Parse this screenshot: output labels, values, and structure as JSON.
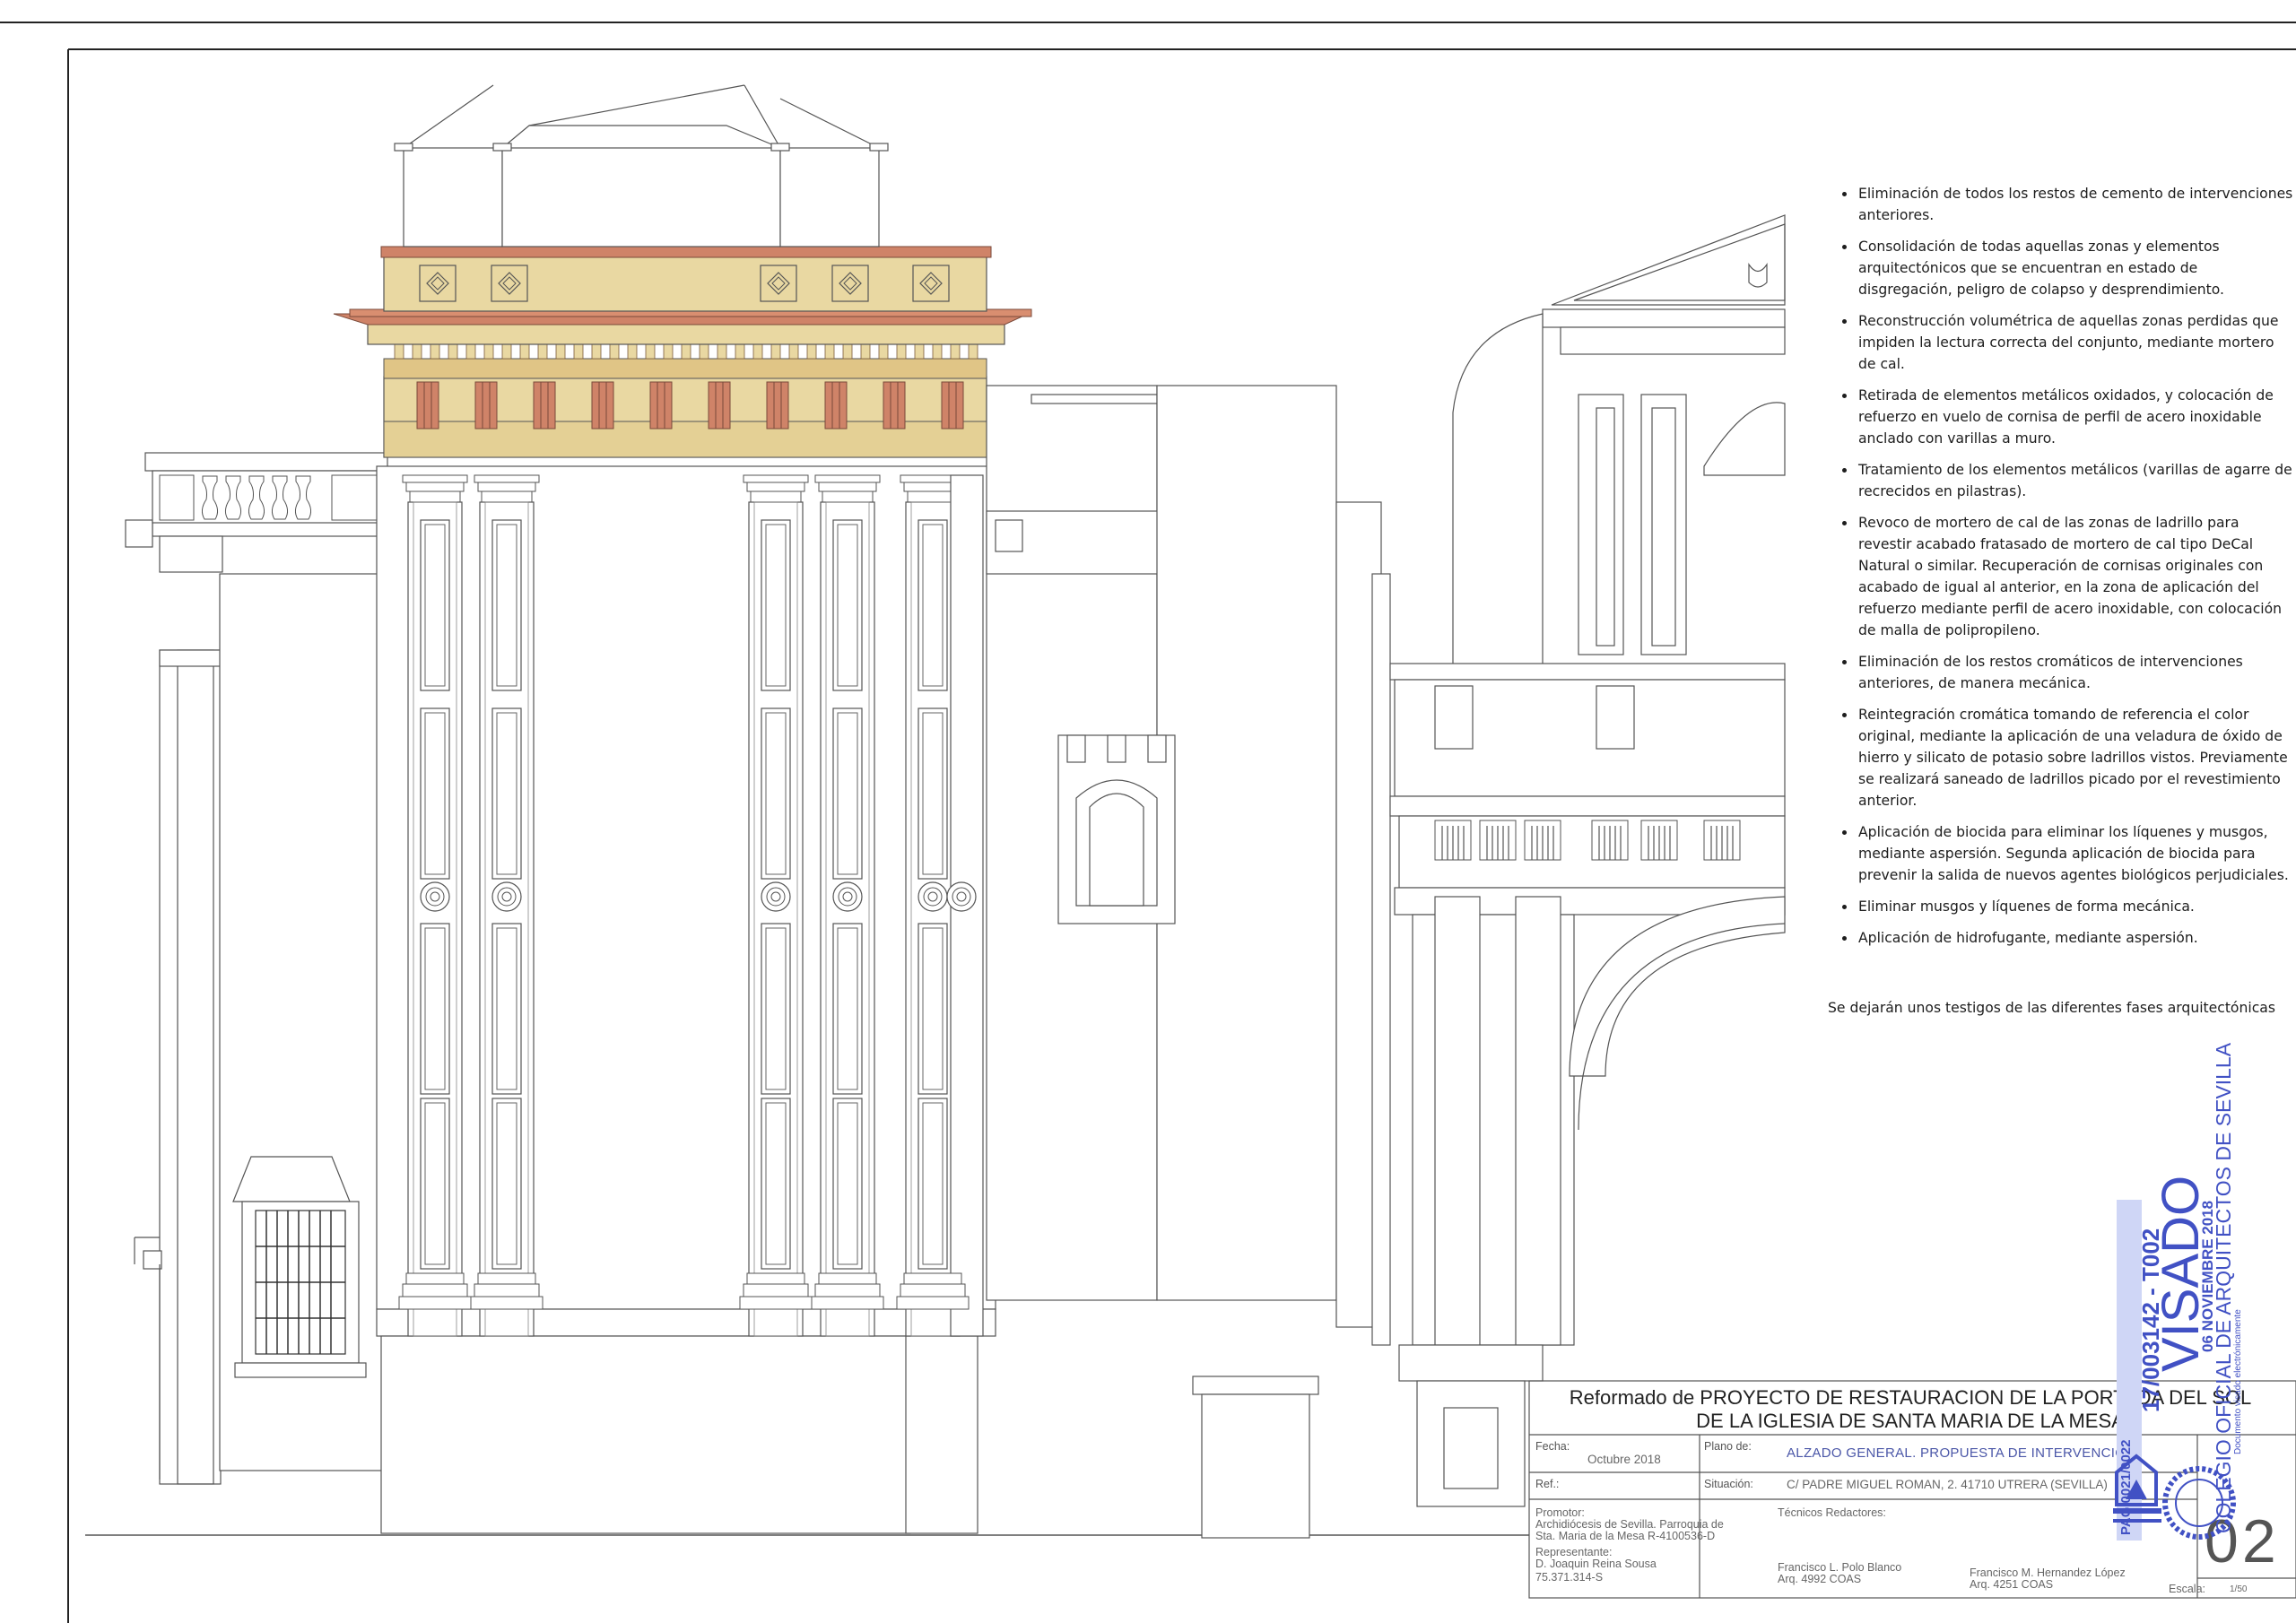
{
  "notes": [
    "Eliminación de todos los restos de cemento de intervenciones anteriores.",
    "Consolidación de todas aquellas zonas y elementos arquitectónicos que se encuentran en estado de disgregación, peligro de colapso y desprendimiento.",
    "Reconstrucción volumétrica de aquellas zonas perdidas que impiden la lectura correcta del conjunto, mediante mortero de cal.",
    "Retirada de elementos metálicos oxidados, y colocación de refuerzo en vuelo de cornisa de perfil de acero inoxidable anclado con varillas a muro.",
    "Tratamiento de los elementos metálicos (varillas de agarre de recrecidos en pilastras).",
    "Revoco de mortero de cal de las zonas de ladrillo para revestir acabado fratasado de mortero de cal tipo DeCal Natural o similar. Recuperación de cornisas originales con acabado de igual al anterior, en la zona de aplicación del refuerzo mediante perfil de acero inoxidable, con colocación de malla de polipropileno.",
    "Eliminación de los restos cromáticos de intervenciones anteriores, de manera mecánica.",
    "Reintegración cromática tomando de referencia el color original, mediante la aplicación de una veladura de óxido de hierro y silicato de potasio sobre ladrillos vistos. Previamente se realizará saneado de ladrillos picado por el revestimiento anterior.",
    "Aplicación de biocida para eliminar los líquenes y musgos, mediante aspersión. Segunda aplicación de biocida para prevenir la salida de nuevos agentes biológicos perjudiciales.",
    "Eliminar musgos y líquenes de forma mecánica.",
    "Aplicación de hidrofugante, mediante aspersión."
  ],
  "closing_note": "Se dejarán unos testigos de las diferentes fases arquitectónicas",
  "title_block": {
    "title_line1": "Reformado de PROYECTO DE RESTAURACION DE LA PORTADA DEL SOL",
    "title_line2": "DE LA IGLESIA DE SANTA MARIA DE LA MESA",
    "fecha_label": "Fecha:",
    "fecha_value": "Octubre 2018",
    "plano_label": "Plano de:",
    "plano_value": "ALZADO GENERAL. PROPUESTA DE INTERVENCION",
    "ref_label": "Ref.:",
    "situacion_label": "Situación:",
    "situacion_value": "C/ PADRE MIGUEL ROMAN, 2. 41710 UTRERA (SEVILLA)",
    "promotor_label": "Promotor:",
    "promotor_line1": "Archidiócesis de Sevilla. Parroquia de",
    "promotor_line2": "Sta. Maria de la Mesa  R-4100536-D",
    "representante_label": "Representante:",
    "representante_name": "D. Joaquin Reina Sousa",
    "representante_id": "75.371.314-S",
    "tecnicos_label": "Técnicos Redactores:",
    "tecnico1_name": "Francisco L. Polo Blanco",
    "tecnico1_reg": "Arq. 4992 COAS",
    "tecnico2_name": "Francisco M. Hernandez López",
    "tecnico2_reg": "Arq. 4251 COAS",
    "sheet_number": "02",
    "escala_label": "Escala:",
    "escala_value": "1/50"
  },
  "stamp": {
    "page": "PAG 0021/0022",
    "expediente": "17/003142 - T002",
    "visado": "VISADO",
    "date": "06 NOVIEMBRE 2018",
    "colegio": "COLEGIO OFICIAL DE ARQUITECTOS DE SEVILLA",
    "electronic": "Documento visado electrónicamente"
  },
  "colors": {
    "line": "#555555",
    "ochre": "#e9d8a2",
    "brick": "#cf8368",
    "stamp_blue": "#4151c4"
  }
}
